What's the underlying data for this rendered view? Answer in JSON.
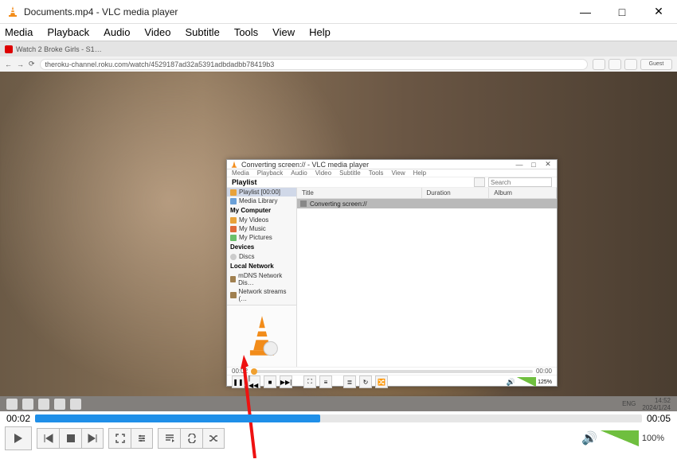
{
  "window": {
    "title": "Documents.mp4 - VLC media player",
    "minimize": "—",
    "maximize": "□",
    "close": "✕"
  },
  "menu": {
    "media": "Media",
    "playback": "Playback",
    "audio": "Audio",
    "video": "Video",
    "subtitle": "Subtitle",
    "tools": "Tools",
    "view": "View",
    "help": "Help"
  },
  "browser": {
    "tab": "Watch 2 Broke Girls - S1…",
    "url": "theroku-channel.roku.com/watch/4529187ad32a5391adbdadbb78419b3",
    "back": "←",
    "forward": "→",
    "reload": "⟳",
    "guest": "Guest"
  },
  "nested": {
    "title": "Converting screen:// - VLC media player",
    "menu": {
      "media": "Media",
      "playback": "Playback",
      "audio": "Audio",
      "video": "Video",
      "subtitle": "Subtitle",
      "tools": "Tools",
      "view": "View",
      "help": "Help"
    },
    "search_label": "Playlist",
    "search_placeholder": "Search",
    "tree": {
      "playlist_hdr": "Playlist",
      "playlist": "Playlist [00:00]",
      "media_library": "Media Library",
      "computer_hdr": "My Computer",
      "my_videos": "My Videos",
      "my_music": "My Music",
      "my_pictures": "My Pictures",
      "devices_hdr": "Devices",
      "discs": "Discs",
      "lan_hdr": "Local Network",
      "mdns": "mDNS Network Dis…",
      "streams": "Network streams (…"
    },
    "columns": {
      "title": "Title",
      "duration": "Duration",
      "album": "Album"
    },
    "row1": "Converting screen://",
    "time_left": "00:02",
    "time_right": "00:00",
    "vol_pct": "125%"
  },
  "taskbar": {
    "lang": "ENG",
    "time": "14:52",
    "date": "2024/1/24"
  },
  "progress": {
    "left": "00:02",
    "right": "00:05"
  },
  "controls": {
    "vol_pct": "100%"
  }
}
